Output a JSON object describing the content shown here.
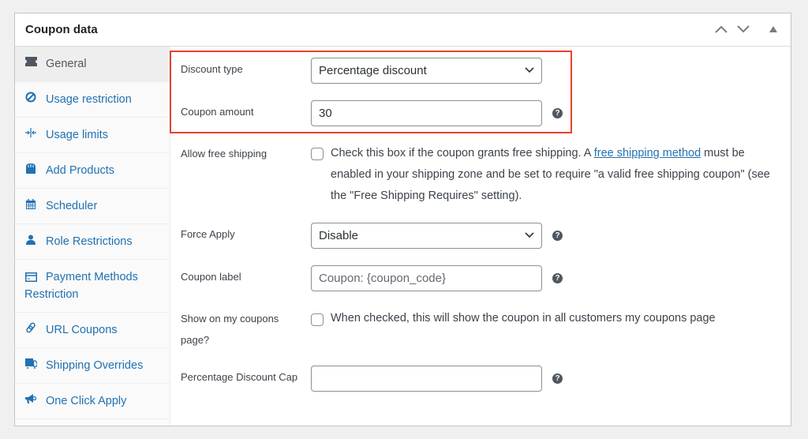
{
  "panel": {
    "title": "Coupon data",
    "header_buttons": [
      "move-up",
      "move-down",
      "toggle-panel"
    ]
  },
  "sidebar": {
    "items": [
      {
        "label": "General",
        "icon": "ticket-icon",
        "active": true
      },
      {
        "label": "Usage restriction",
        "icon": "block-icon",
        "active": false
      },
      {
        "label": "Usage limits",
        "icon": "limits-icon",
        "active": false
      },
      {
        "label": "Add Products",
        "icon": "bag-icon",
        "active": false
      },
      {
        "label": "Scheduler",
        "icon": "calendar-icon",
        "active": false
      },
      {
        "label": "Role Restrictions",
        "icon": "user-icon",
        "active": false
      },
      {
        "label": "Payment Methods Restriction",
        "icon": "card-icon",
        "active": false
      },
      {
        "label": "URL Coupons",
        "icon": "link-icon",
        "active": false
      },
      {
        "label": "Shipping Overrides",
        "icon": "truck-icon",
        "active": false
      },
      {
        "label": "One Click Apply",
        "icon": "megaphone-icon",
        "active": false
      }
    ]
  },
  "fields": {
    "discount_type": {
      "label": "Discount type",
      "value": "Percentage discount"
    },
    "coupon_amount": {
      "label": "Coupon amount",
      "value": "30"
    },
    "free_shipping": {
      "label": "Allow free shipping",
      "checked": false,
      "text_before": "Check this box if the coupon grants free shipping. A ",
      "link": "free shipping method",
      "text_after": " must be enabled in your shipping zone and be set to require \"a valid free shipping coupon\" (see the \"Free Shipping Requires\" setting)."
    },
    "force_apply": {
      "label": "Force Apply",
      "value": "Disable"
    },
    "coupon_label": {
      "label": "Coupon label",
      "value": "",
      "placeholder": "Coupon: {coupon_code}"
    },
    "show_on_my_coupons": {
      "label": "Show on my coupons page?",
      "checked": false,
      "text": "When checked, this will show the coupon in all customers my coupons page"
    },
    "percentage_discount_cap": {
      "label": "Percentage Discount Cap",
      "value": ""
    }
  },
  "help_glyph": "?",
  "highlight_color": "#e8412c"
}
